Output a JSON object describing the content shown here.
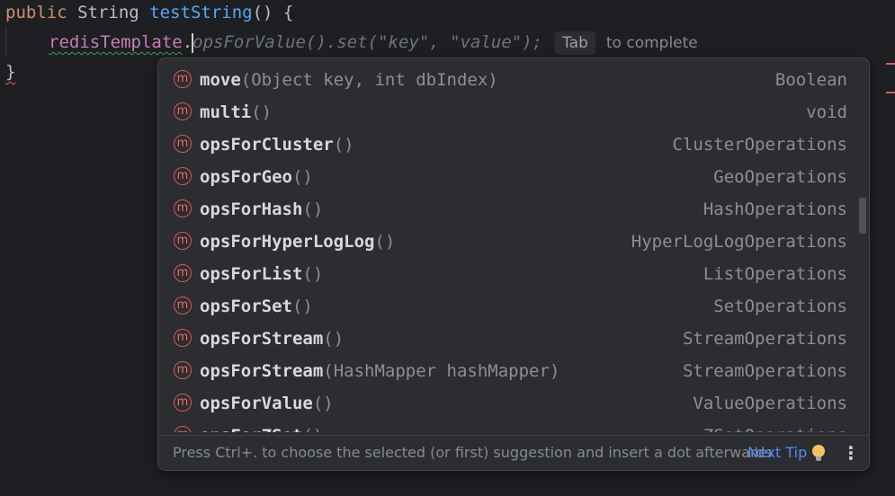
{
  "editor": {
    "line1": {
      "kw": "public",
      "type": "String",
      "method": "testString",
      "rest": "() {"
    },
    "line2": {
      "field": "redisTemplate",
      "dot": ".",
      "ghost": "opsForValue().set(\"key\", \"value\");",
      "tab_badge": "Tab",
      "hint": "to complete"
    },
    "line3": {
      "brace": "}"
    }
  },
  "completion": {
    "items": [
      {
        "name": "move",
        "params": "(Object key, int dbIndex)",
        "return_type": "Boolean",
        "icon": "method-icon",
        "icon_glyph": "m"
      },
      {
        "name": "multi",
        "params": "()",
        "return_type": "void",
        "icon": "method-icon",
        "icon_glyph": "m"
      },
      {
        "name": "opsForCluster",
        "params": "()",
        "return_type": "ClusterOperations",
        "icon": "method-icon",
        "icon_glyph": "m"
      },
      {
        "name": "opsForGeo",
        "params": "()",
        "return_type": "GeoOperations",
        "icon": "method-icon",
        "icon_glyph": "m"
      },
      {
        "name": "opsForHash",
        "params": "()",
        "return_type": "HashOperations",
        "icon": "method-icon",
        "icon_glyph": "m"
      },
      {
        "name": "opsForHyperLogLog",
        "params": "()",
        "return_type": "HyperLogLogOperations",
        "icon": "method-icon",
        "icon_glyph": "m"
      },
      {
        "name": "opsForList",
        "params": "()",
        "return_type": "ListOperations",
        "icon": "method-icon",
        "icon_glyph": "m"
      },
      {
        "name": "opsForSet",
        "params": "()",
        "return_type": "SetOperations",
        "icon": "method-icon",
        "icon_glyph": "m"
      },
      {
        "name": "opsForStream",
        "params": "()",
        "return_type": "StreamOperations",
        "icon": "method-icon",
        "icon_glyph": "m"
      },
      {
        "name": "opsForStream",
        "params": "(HashMapper hashMapper)",
        "return_type": "StreamOperations",
        "icon": "method-icon",
        "icon_glyph": "m"
      },
      {
        "name": "opsForValue",
        "params": "()",
        "return_type": "ValueOperations",
        "icon": "method-icon",
        "icon_glyph": "m"
      },
      {
        "name": "opsForZSet",
        "params": "()",
        "return_type": "ZSetOperations",
        "icon": "method-icon",
        "icon_glyph": "m"
      }
    ],
    "footer": {
      "text": "Press Ctrl+. to choose the selected (or first) suggestion and insert a dot afterwards",
      "next_tip": "Next Tip",
      "more_glyph": "⋮"
    }
  },
  "colors": {
    "background": "#1e1f22",
    "popup_background": "#2b2d30",
    "keyword": "#cf8e6d",
    "method": "#56a8f5",
    "field": "#c77dbb",
    "method_icon": "#e05555",
    "link": "#548af7",
    "error": "#db5c5c"
  }
}
